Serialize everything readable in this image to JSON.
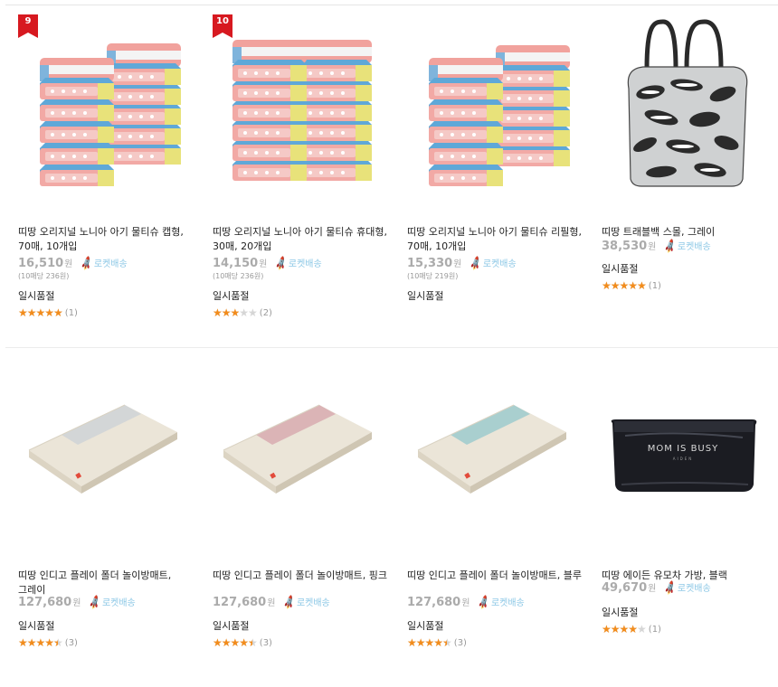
{
  "products": [
    {
      "rank": "9",
      "name": "띠땅 오리지널 노니아 아기 물티슈 캡형, 70매, 10개입",
      "price": "16,510",
      "won": "원",
      "rocket": "로켓배송",
      "unit_price": "(10매당 236원)",
      "status": "일시품절",
      "rating": 1.0,
      "review_count": "(1)",
      "image": "wet-wipes-cap-pack-image"
    },
    {
      "rank": "10",
      "name": "띠땅 오리지널 노니아 아기 물티슈 휴대형, 30매, 20개입",
      "price": "14,150",
      "won": "원",
      "rocket": "로켓배송",
      "unit_price": "(10매당 236원)",
      "status": "일시품절",
      "rating": 0.6,
      "review_count": "(2)",
      "image": "wet-wipes-portable-pack-image"
    },
    {
      "rank": "",
      "name": "띠땅 오리지널 노니아 아기 물티슈 리필형, 70매, 10개입",
      "price": "15,330",
      "won": "원",
      "rocket": "로켓배송",
      "unit_price": "(10매당 219원)",
      "status": "일시품절",
      "rating": null,
      "review_count": "",
      "image": "wet-wipes-refill-pack-image"
    },
    {
      "rank": "",
      "name": "띠땅 트래블백 스몰, 그레이",
      "price": "38,530",
      "won": "원",
      "rocket": "로켓배송",
      "unit_price": "",
      "status": "일시품절",
      "rating": 1.0,
      "review_count": "(1)",
      "image": "travel-bag-gray-image"
    },
    {
      "rank": "",
      "name": "띠땅 인디고 플레이 폴더 놀이방매트, 그레이",
      "price": "127,680",
      "won": "원",
      "rocket": "로켓배송",
      "unit_price": "",
      "status": "일시품절",
      "rating": 0.9,
      "review_count": "(3)",
      "image": "play-mat-gray-image",
      "mat_color": "#d3d6d7"
    },
    {
      "rank": "",
      "name": "띠땅 인디고 플레이 폴더 놀이방매트, 핑크",
      "price": "127,680",
      "won": "원",
      "rocket": "로켓배송",
      "unit_price": "",
      "status": "일시품절",
      "rating": 0.9,
      "review_count": "(3)",
      "image": "play-mat-pink-image",
      "mat_color": "#dbb4b6"
    },
    {
      "rank": "",
      "name": "띠땅 인디고 플레이 폴더 놀이방매트, 블루",
      "price": "127,680",
      "won": "원",
      "rocket": "로켓배송",
      "unit_price": "",
      "status": "일시품절",
      "rating": 0.9,
      "review_count": "(3)",
      "image": "play-mat-blue-image",
      "mat_color": "#a9cfcf"
    },
    {
      "rank": "",
      "name": "띠땅 에이든 유모차 가방, 블랙",
      "price": "49,670",
      "won": "원",
      "rocket": "로켓배송",
      "unit_price": "",
      "status": "일시품절",
      "rating": 0.8,
      "review_count": "(1)",
      "image": "stroller-bag-black-image",
      "bag_logo": "MOM IS BUSY",
      "bag_sub": "AIDEN"
    }
  ],
  "colors": {
    "rank_badge": "#d71920",
    "star": "#f28c1c",
    "rocket": "#8dc8e6",
    "price": "#ababab"
  }
}
